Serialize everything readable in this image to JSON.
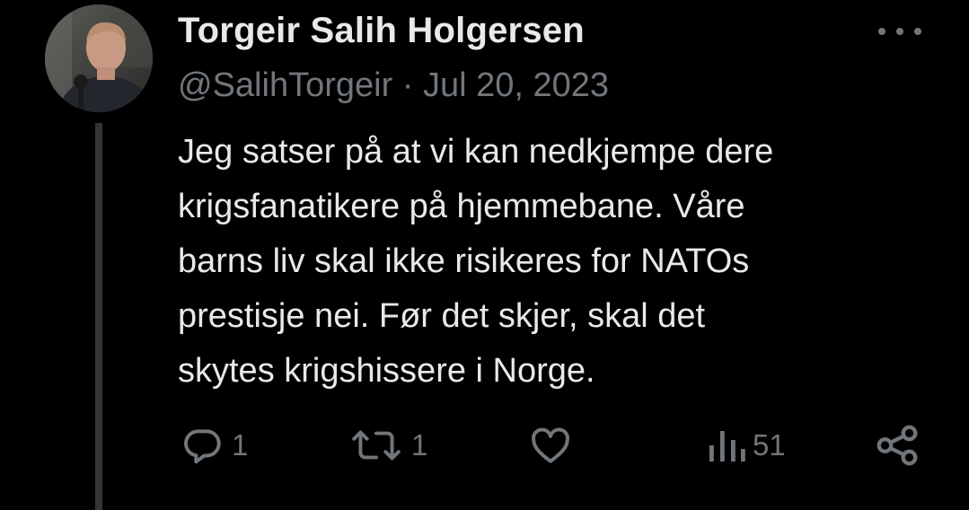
{
  "author": {
    "display_name": "Torgeir Salih Holgersen",
    "handle": "@SalihTorgeir",
    "separator": "·",
    "date": "Jul 20, 2023"
  },
  "tweet": {
    "lines": [
      "Jeg satser på at vi kan nedkjempe dere",
      "krigsfanatikere på hjemmebane. Våre",
      "barns liv skal ikke risikeres for NATOs",
      "prestisje nei. Før det skjer, skal det",
      "skytes krigshissere i Norge."
    ]
  },
  "actions": {
    "replies": "1",
    "retweets": "1",
    "views": "51"
  },
  "icons": {
    "more": "more-icon",
    "reply": "reply-icon",
    "retweet": "retweet-icon",
    "like": "heart-icon",
    "views": "views-icon",
    "share": "share-icon"
  },
  "colors": {
    "background": "#000000",
    "primary_text": "#e7e9ea",
    "secondary_text": "#71767b",
    "thread_line": "#333639"
  }
}
